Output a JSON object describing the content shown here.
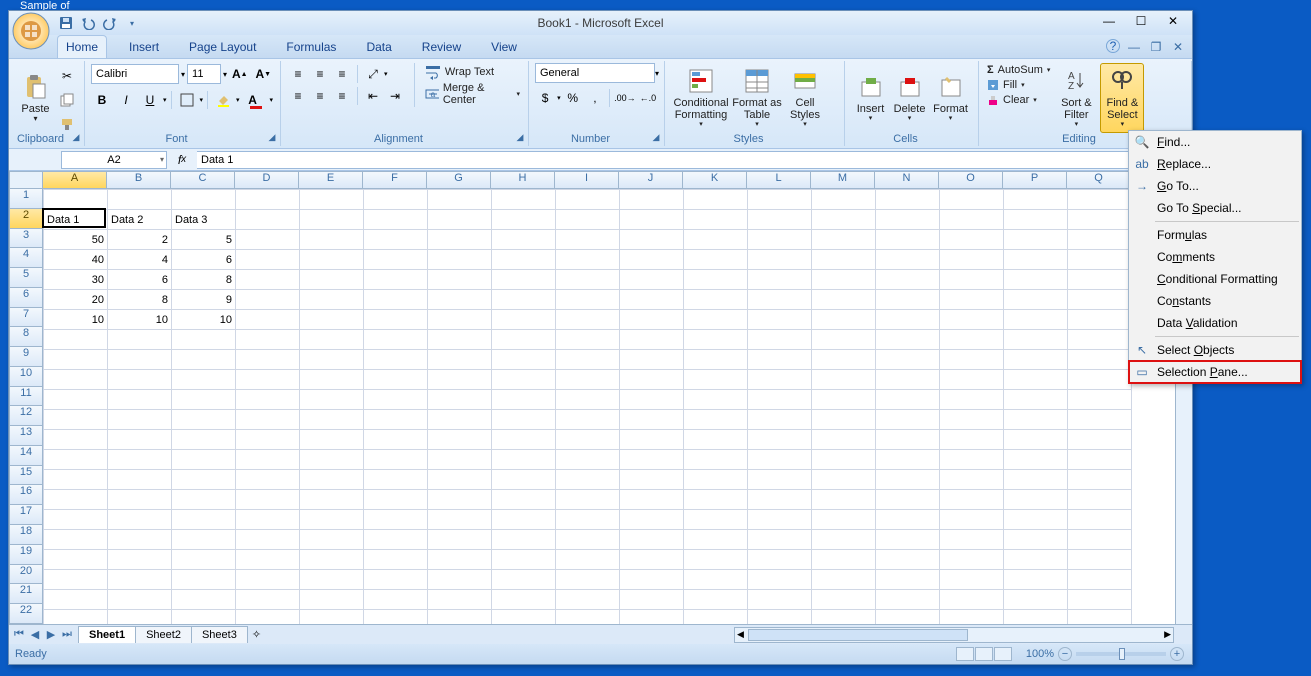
{
  "desktop": {
    "sample_text": "Sample of"
  },
  "title": "Book1 - Microsoft Excel",
  "tabs": [
    "Home",
    "Insert",
    "Page Layout",
    "Formulas",
    "Data",
    "Review",
    "View"
  ],
  "active_tab": "Home",
  "ribbon": {
    "clipboard": {
      "label": "Clipboard",
      "paste": "Paste"
    },
    "font": {
      "label": "Font",
      "name": "Calibri",
      "size": "11"
    },
    "alignment": {
      "label": "Alignment",
      "wrap": "Wrap Text",
      "merge": "Merge & Center"
    },
    "number": {
      "label": "Number",
      "format": "General"
    },
    "styles": {
      "label": "Styles",
      "cond": "Conditional Formatting",
      "table": "Format as Table",
      "cell": "Cell Styles"
    },
    "cells": {
      "label": "Cells",
      "insert": "Insert",
      "delete": "Delete",
      "format": "Format"
    },
    "editing": {
      "label": "Editing",
      "autosum": "AutoSum",
      "fill": "Fill",
      "clear": "Clear",
      "sort": "Sort & Filter",
      "find": "Find & Select"
    }
  },
  "namebox": "A2",
  "formula_bar": "Data 1",
  "columns": [
    "A",
    "B",
    "C",
    "D",
    "E",
    "F",
    "G",
    "H",
    "I",
    "J",
    "K",
    "L",
    "M",
    "N",
    "O",
    "P",
    "Q"
  ],
  "rowcount": 22,
  "active_cell": {
    "row": 2,
    "col": 1
  },
  "data": {
    "2": {
      "A": "Data 1",
      "B": "Data 2",
      "C": "Data 3"
    },
    "3": {
      "A": 50,
      "B": 2,
      "C": 5
    },
    "4": {
      "A": 40,
      "B": 4,
      "C": 6
    },
    "5": {
      "A": 30,
      "B": 6,
      "C": 8
    },
    "6": {
      "A": 20,
      "B": 8,
      "C": 9
    },
    "7": {
      "A": 10,
      "B": 10,
      "C": 10
    }
  },
  "sheets": [
    "Sheet1",
    "Sheet2",
    "Sheet3"
  ],
  "active_sheet": "Sheet1",
  "status": "Ready",
  "zoom": "100%",
  "menu": {
    "items": [
      {
        "icon": "🔍",
        "html": "<u>F</u>ind..."
      },
      {
        "icon": "ab",
        "html": "<u>R</u>eplace..."
      },
      {
        "icon": "→",
        "html": "<u>G</u>o To..."
      },
      {
        "html": "Go To <u>S</u>pecial..."
      },
      {
        "sep": true
      },
      {
        "html": "Form<u>u</u>las"
      },
      {
        "html": "Co<u>m</u>ments"
      },
      {
        "html": "<u>C</u>onditional Formatting"
      },
      {
        "html": "Co<u>n</u>stants"
      },
      {
        "html": "Data <u>V</u>alidation"
      },
      {
        "sep": true
      },
      {
        "icon": "↖",
        "html": "Select <u>O</u>bjects"
      },
      {
        "icon": "▭",
        "html": "Selection <u>P</u>ane...",
        "boxed": true
      }
    ]
  }
}
